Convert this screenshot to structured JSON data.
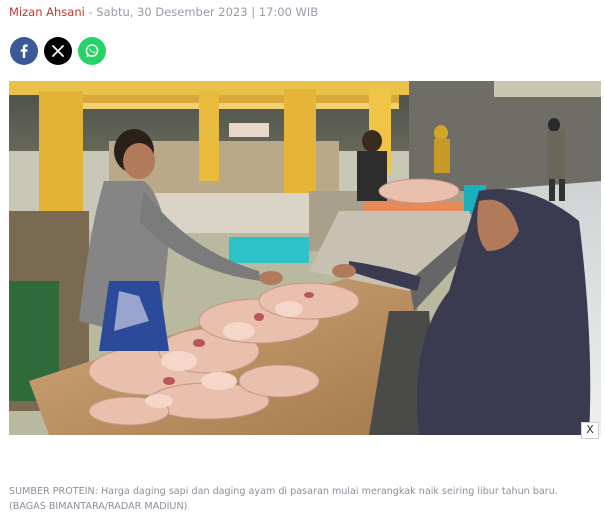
{
  "byline": {
    "author": "Mizan Ahsani",
    "separator": " - ",
    "datetime": "Sabtu, 30 Desember 2023 | 17:00 WIB"
  },
  "share": [
    {
      "icon": "facebook-icon",
      "color": "#3b5998"
    },
    {
      "icon": "x-icon",
      "color": "#000000"
    },
    {
      "icon": "whatsapp-icon",
      "color": "#25d366"
    }
  ],
  "ad_close": {
    "label": "X"
  },
  "caption": {
    "text": "SUMBER PROTEIN: Harga daging sapi dan daging ayam di pasaran mulai merangkak naik seiring libur tahun baru.",
    "credit": "(BAGAS BIMANTARA/RADAR MADIUN)"
  }
}
